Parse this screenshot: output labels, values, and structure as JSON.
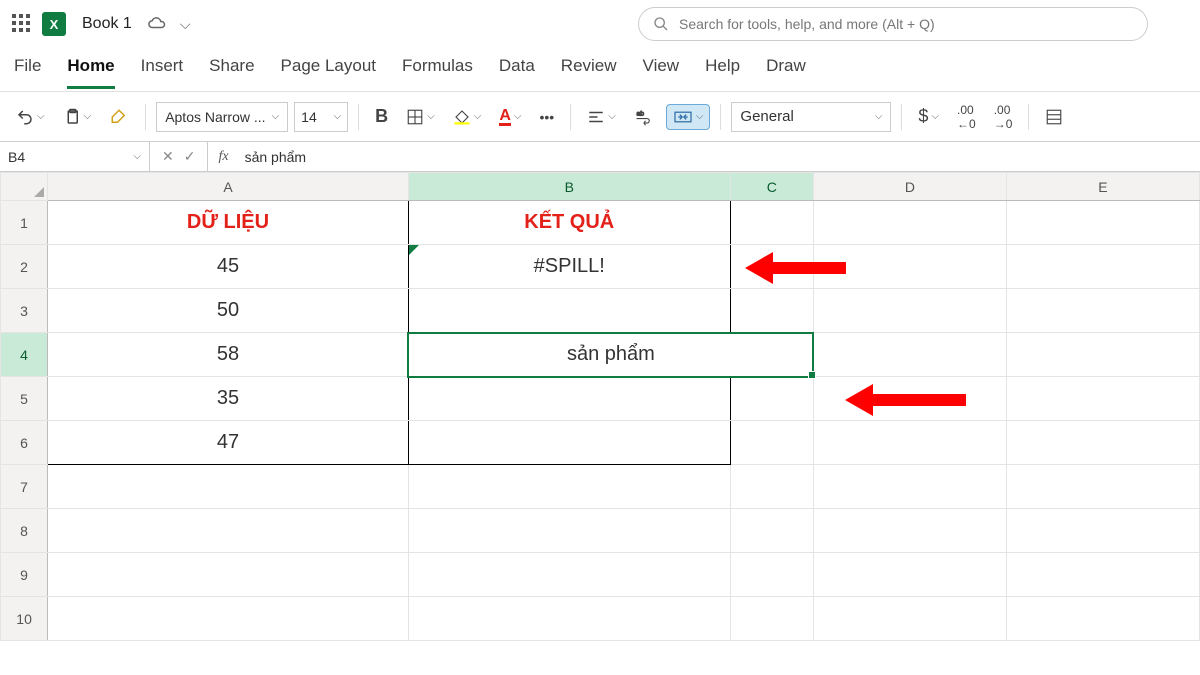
{
  "titlebar": {
    "doc_name": "Book 1"
  },
  "search": {
    "placeholder": "Search for tools, help, and more (Alt + Q)"
  },
  "tabs": [
    "File",
    "Home",
    "Insert",
    "Share",
    "Page Layout",
    "Formulas",
    "Data",
    "Review",
    "View",
    "Help",
    "Draw"
  ],
  "active_tab": "Home",
  "ribbon": {
    "font_name": "Aptos Narrow ...",
    "font_size": "14",
    "number_format": "General"
  },
  "formula_bar": {
    "cell_ref": "B4",
    "formula": "sản phẩm"
  },
  "columns": [
    "A",
    "B",
    "C",
    "D",
    "E"
  ],
  "rows": [
    1,
    2,
    3,
    4,
    5,
    6,
    7,
    8,
    9,
    10
  ],
  "selected_col_headers": [
    "B",
    "C"
  ],
  "selected_row_header": 4,
  "cells": {
    "A1": "DỮ LIỆU",
    "B1": "KẾT QUẢ",
    "A2": "45",
    "B2": "#SPILL!",
    "A3": "50",
    "A4": "58",
    "B4": "sản phẩm",
    "A5": "35",
    "A6": "47"
  }
}
